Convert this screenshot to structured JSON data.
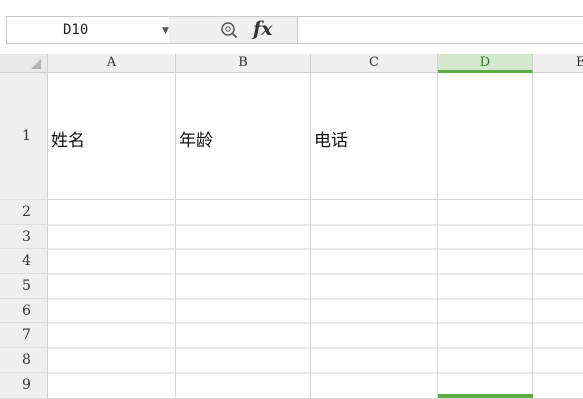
{
  "formula_bar": {
    "name_box": "D10",
    "fx_label": "fx",
    "formula_value": ""
  },
  "sheet": {
    "columns": [
      "A",
      "B",
      "C",
      "D",
      "E"
    ],
    "selected_column": "D",
    "rows": [
      "1",
      "2",
      "3",
      "4",
      "5",
      "6",
      "7",
      "8",
      "9"
    ],
    "cells": {
      "A1": "姓名",
      "B1": "年龄",
      "C1": "电话"
    }
  },
  "colors": {
    "selection_accent": "#5cad44",
    "selected_header_bg": "#d5e8cf"
  }
}
